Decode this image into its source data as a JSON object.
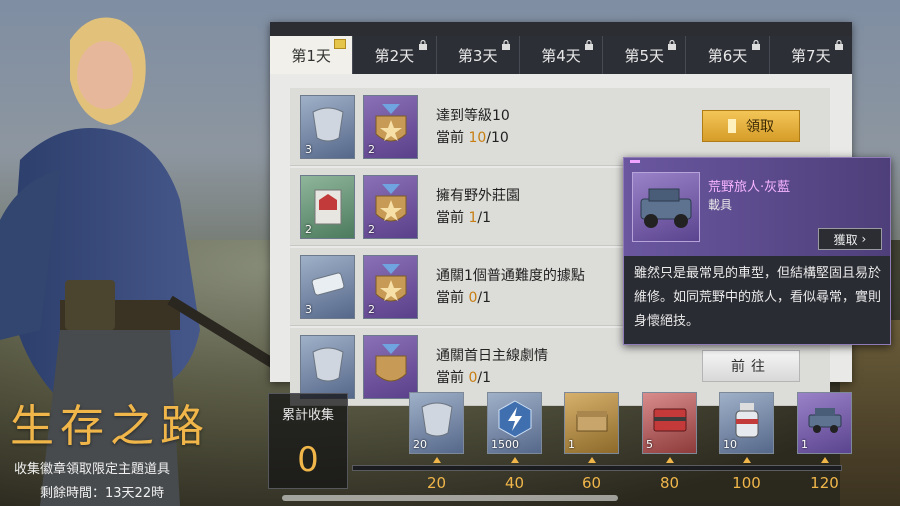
{
  "tabs": [
    {
      "label": "第1天",
      "state": "active",
      "icon": "gift-icon"
    },
    {
      "label": "第2天",
      "state": "locked",
      "icon": "lock-icon"
    },
    {
      "label": "第3天",
      "state": "locked",
      "icon": "lock-icon"
    },
    {
      "label": "第4天",
      "state": "locked",
      "icon": "lock-icon"
    },
    {
      "label": "第5天",
      "state": "locked",
      "icon": "lock-icon"
    },
    {
      "label": "第6天",
      "state": "locked",
      "icon": "lock-icon"
    },
    {
      "label": "第7天",
      "state": "locked",
      "icon": "lock-icon"
    }
  ],
  "tasks": [
    {
      "title": "達到等級10",
      "progress_prefix": "當前 ",
      "progress_current": "10",
      "progress_total": "/10",
      "rewards": [
        {
          "qty": "3",
          "icon": "armor-plate-icon"
        },
        {
          "qty": "2",
          "icon": "badge-icon"
        }
      ],
      "button": "領取",
      "button_type": "claim"
    },
    {
      "title": "擁有野外莊園",
      "progress_prefix": "當前 ",
      "progress_current": "1",
      "progress_total": "/1",
      "rewards": [
        {
          "qty": "2",
          "icon": "supply-bag-icon"
        },
        {
          "qty": "2",
          "icon": "badge-icon"
        }
      ],
      "button": "",
      "button_type": "hidden"
    },
    {
      "title": "通關1個普通難度的據點",
      "progress_prefix": "當前 ",
      "progress_current": "0",
      "progress_total": "/1",
      "rewards": [
        {
          "qty": "3",
          "icon": "bandage-icon"
        },
        {
          "qty": "2",
          "icon": "badge-icon"
        }
      ],
      "button": "",
      "button_type": "hidden"
    },
    {
      "title": "通關首日主線劇情",
      "progress_prefix": "當前 ",
      "progress_current": "0",
      "progress_total": "/1",
      "rewards": [
        {
          "qty": "",
          "icon": "armor-plate-icon"
        },
        {
          "qty": "",
          "icon": "badge-icon"
        }
      ],
      "button": "前往",
      "button_type": "go"
    }
  ],
  "tooltip": {
    "name": "荒野旅人·灰藍",
    "type": "載具",
    "button": "獲取",
    "description": "雖然只是最常見的車型，但結構堅固且易於維修。如同荒野中的旅人，看似尋常，實則身懷絕技。"
  },
  "event": {
    "title": "生存之路",
    "subtitle": "收集徽章領取限定主題道具",
    "remaining_label": "剩餘時間：",
    "remaining_value": "13天22時"
  },
  "cumulative": {
    "label": "累計收集",
    "value": "0"
  },
  "milestones": [
    {
      "threshold": "20",
      "qty": "20",
      "icon": "armor-plate-icon",
      "rarity": "blue"
    },
    {
      "threshold": "40",
      "qty": "1500",
      "icon": "energy-icon",
      "rarity": "blue"
    },
    {
      "threshold": "60",
      "qty": "1",
      "icon": "ammo-box-icon",
      "rarity": "gold"
    },
    {
      "threshold": "80",
      "qty": "5",
      "icon": "crate-icon",
      "rarity": "red"
    },
    {
      "threshold": "100",
      "qty": "10",
      "icon": "grenade-icon",
      "rarity": "blue"
    },
    {
      "threshold": "120",
      "qty": "1",
      "icon": "jeep-icon",
      "rarity": "purple"
    }
  ],
  "colors": {
    "accent": "#f0b64a",
    "progress_highlight": "#c77e12",
    "tooltip_name": "#f5b3ff"
  }
}
